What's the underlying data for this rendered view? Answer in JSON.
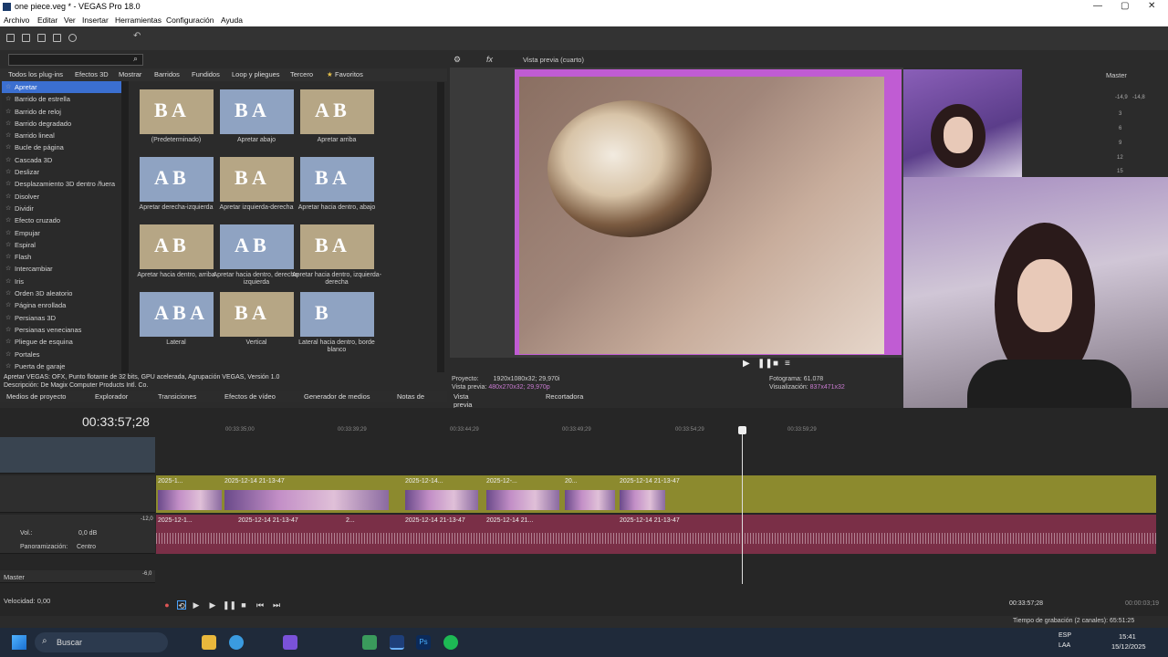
{
  "window": {
    "title": "one piece.veg * - VEGAS Pro 18.0",
    "min": "—",
    "max": "▢",
    "close": "✕"
  },
  "menu": [
    "Archivo",
    "Editar",
    "Ver",
    "Insertar",
    "Herramientas",
    "Configuración",
    "Ayuda"
  ],
  "fx_tabs": [
    "Todos los plug-ins",
    "Efectos 3D",
    "Mostrar",
    "Barridos",
    "Fundidos",
    "Loop y pliegues",
    "Tercero",
    "Favoritos"
  ],
  "fx_list": [
    "Apretar",
    "Barrido de estrella",
    "Barrido de reloj",
    "Barrido degradado",
    "Barrido lineal",
    "Bucle de página",
    "Cascada 3D",
    "Deslizar",
    "Desplazamiento 3D dentro /fuera",
    "Disolver",
    "Dividir",
    "Efecto cruzado",
    "Empujar",
    "Espiral",
    "Flash",
    "Intercambiar",
    "Iris",
    "Orden 3D aleatorio",
    "Página enrollada",
    "Persianas 3D",
    "Persianas venecianas",
    "Pliegue de esquina",
    "Portales",
    "Puerta de garaje"
  ],
  "presets": [
    {
      "glyph": "B A",
      "caption": "(Predeterminado)"
    },
    {
      "glyph": "B A",
      "caption": "Apretar abajo"
    },
    {
      "glyph": "A B",
      "caption": "Apretar arriba"
    },
    {
      "glyph": "A B",
      "caption": "Apretar derecha-izquierda"
    },
    {
      "glyph": "B A",
      "caption": "Apretar izquierda-derecha"
    },
    {
      "glyph": "B A",
      "caption": "Apretar hacia dentro, abajo"
    },
    {
      "glyph": "A B",
      "caption": "Apretar hacia dentro, arriba"
    },
    {
      "glyph": "A B",
      "caption": "Apretar hacia dentro, derecha-izquierda"
    },
    {
      "glyph": "B A",
      "caption": "Apretar hacia dentro, izquierda-derecha"
    },
    {
      "glyph": "A B A",
      "caption": "Lateral"
    },
    {
      "glyph": "B A",
      "caption": "Vertical"
    },
    {
      "glyph": "B",
      "caption": "Lateral hacia dentro, borde blanco"
    }
  ],
  "description": [
    "Apretar VEGAS: OFX, Punto flotante de 32 bits, GPU acelerada, Agrupación VEGAS, Versión 1.0",
    "Descripción: De Magix Computer Products Intl. Co."
  ],
  "bottom_tabs": [
    "Medios de proyecto",
    "Explorador",
    "Transiciones",
    "Efectos de vídeo",
    "Generador de medios",
    "Notas de"
  ],
  "preview": {
    "mode": "Vista previa (cuarto)",
    "proyecto_label": "Proyecto:",
    "proyecto": "1920x1080x32; 29,970i",
    "vista_label": "Vista previa:",
    "vista": "480x270x32; 29,970p",
    "fotograma_label": "Fotograma:",
    "fotograma": "61.078",
    "visual_label": "Visualización:",
    "visual": "837x471x32",
    "tabs": [
      "Vista previa de vídeo",
      "Recortadora"
    ]
  },
  "master": {
    "label": "Master",
    "scale": [
      "-14,9",
      "-14,8",
      "3",
      "6",
      "9",
      "12",
      "15"
    ]
  },
  "timeline": {
    "timecode": "00:33:57;28",
    "ruler": [
      "00:33:35;00",
      "00:33:39;29",
      "00:33:44;29",
      "00:33:49;29",
      "00:33:54;29",
      "00:33:59;29"
    ],
    "video_clips": [
      "2025-1...",
      "2025-12-14 21-13-47",
      "2025-12-14...",
      "2025-12-...",
      "20...",
      "2025-12-14 21-13-47"
    ],
    "audio_clips": [
      "2025-12-1...",
      "2025-12-14 21-13-47",
      "2...",
      "2025-12-14 21-13-47",
      "2025-12-14 21...",
      "2025-12-14 21-13-47"
    ],
    "vol_label": "Vol.:",
    "vol": "0,0 dB",
    "pan_label": "Panoramización:",
    "pan": "Centro",
    "master_label": "Master",
    "speed": "Velocidad: 0,00",
    "db_a": "-12,0",
    "db_b": "-6,0",
    "end_tc": "00:33:57;28",
    "end_tc2": "00:00:03;19"
  },
  "status_text": "Tiempo de grabación (2 canales): 65:51:25",
  "taskbar": {
    "search": "Buscar",
    "lang1": "ESP",
    "lang2": "LAA",
    "time": "15:41",
    "date": "15/12/2025"
  }
}
